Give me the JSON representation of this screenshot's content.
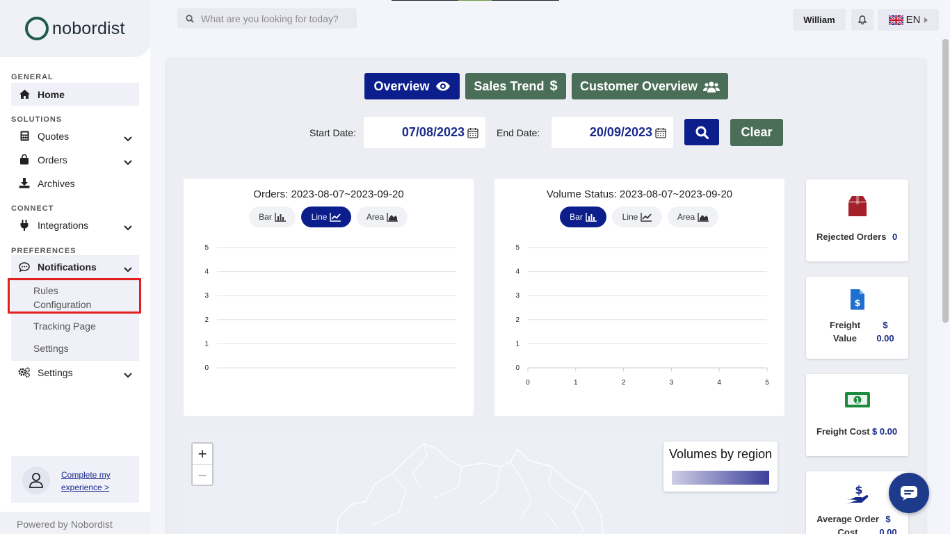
{
  "app": {
    "logo_text": "nobordist",
    "powered_by": "Powered by Nobordist"
  },
  "sidebar": {
    "sections": {
      "general": "GENERAL",
      "solutions": "SOLUTIONS",
      "connect": "CONNECT",
      "preferences": "PREFERENCES"
    },
    "items": {
      "home": "Home",
      "quotes": "Quotes",
      "orders": "Orders",
      "archives": "Archives",
      "integrations": "Integrations",
      "notifications": "Notifications",
      "settings": "Settings"
    },
    "notifications_sub": {
      "rules_line1": "Rules",
      "rules_line2": "Configuration",
      "tracking": "Tracking Page",
      "settings": "Settings"
    },
    "profile_link_line1": "Complete my",
    "profile_link_line2": "experience >"
  },
  "header": {
    "search_placeholder": "What are you looking for today?",
    "user": "William",
    "language": "EN"
  },
  "dashboard": {
    "tabs": {
      "overview": "Overview",
      "sales_trend": "Sales Trend",
      "customer_overview": "Customer Overview"
    },
    "start_date_label": "Start Date:",
    "start_date": "07/08/2023",
    "end_date_label": "End Date:",
    "end_date": "20/09/2023",
    "clear": "Clear",
    "chart_toggle": {
      "bar": "Bar",
      "line": "Line",
      "area": "Area"
    }
  },
  "stats": {
    "rejected": {
      "label": "Rejected Orders",
      "value": "0"
    },
    "freight_value": {
      "label_line1": "Freight",
      "label_line2": "Value",
      "value_line1": "$",
      "value_line2": "0.00"
    },
    "freight_cost": {
      "label": "Freight Cost",
      "value": "$ 0.00"
    },
    "avg_order": {
      "label_line1": "Average Order",
      "label_line2": "Cost",
      "value_line1": "$",
      "value_line2": "0.00"
    }
  },
  "map": {
    "legend_title": "Volumes by region",
    "zoom_in": "+",
    "zoom_out": "−"
  },
  "colors": {
    "primary": "#0b1e8c",
    "green": "#4b6e58",
    "accent_red": "#a5202a"
  },
  "chart_data": [
    {
      "type": "line",
      "title": "Orders: 2023-08-07~2023-09-20",
      "x": [],
      "series": [],
      "ylim": [
        0,
        5
      ],
      "yticks": [
        "0",
        "1",
        "2",
        "3",
        "4",
        "5"
      ],
      "xticks": [],
      "grid": true
    },
    {
      "type": "bar",
      "title": "Volume Status: 2023-08-07~2023-09-20",
      "categories": [],
      "series": [],
      "ylim": [
        0,
        5
      ],
      "xlim": [
        0,
        5
      ],
      "yticks": [
        "0",
        "1",
        "2",
        "3",
        "4",
        "5"
      ],
      "xticks": [
        "0",
        "1",
        "2",
        "3",
        "4",
        "5"
      ],
      "grid": true
    }
  ]
}
